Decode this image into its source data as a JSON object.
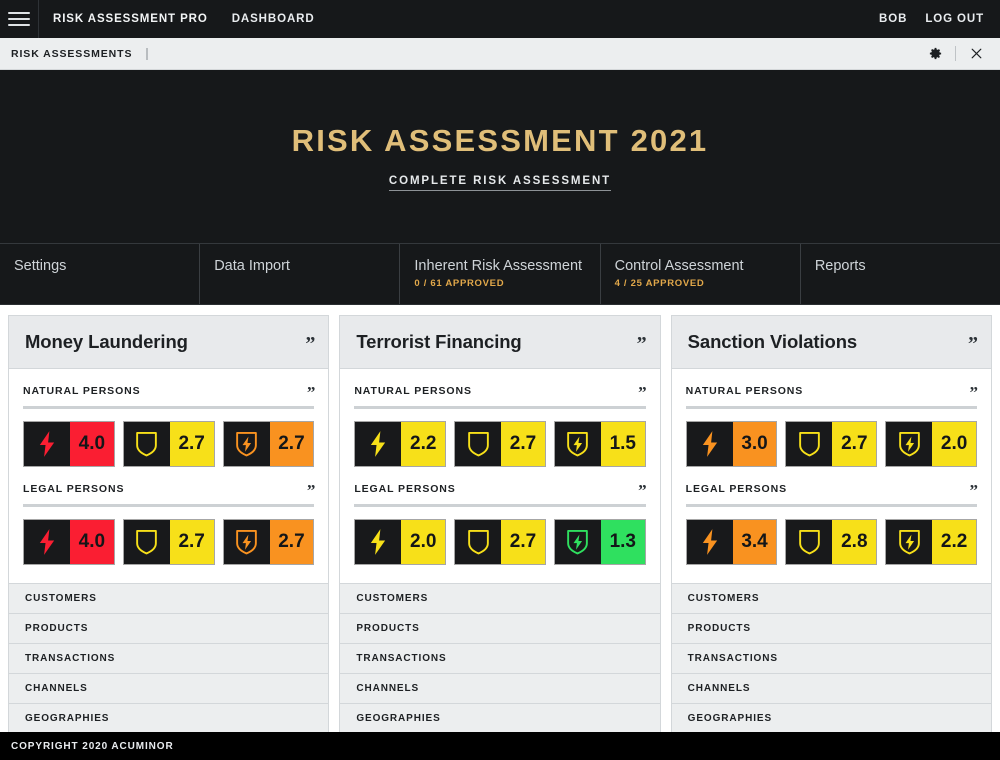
{
  "topnav": {
    "menu_icon": "hamburger-icon",
    "brand": "RISK ASSESSMENT PRO",
    "dashboard": "DASHBOARD",
    "user": "BOB",
    "logout": "LOG OUT"
  },
  "subbar": {
    "tab": "RISK ASSESSMENTS",
    "settings_icon": "gear-icon",
    "close_icon": "close-icon"
  },
  "hero": {
    "title": "RISK ASSESSMENT 2021",
    "subtitle": "COMPLETE RISK ASSESSMENT",
    "title_color": "#e0be79"
  },
  "tabs": [
    {
      "label": "Settings",
      "meta": ""
    },
    {
      "label": "Data Import",
      "meta": ""
    },
    {
      "label": "Inherent Risk Assessment",
      "meta": "0 / 61 APPROVED"
    },
    {
      "label": "Control Assessment",
      "meta": "4 / 25 APPROVED"
    },
    {
      "label": "Reports",
      "meta": ""
    }
  ],
  "badge_icons": {
    "inherent": "lightning-bolt-icon",
    "control": "shield-icon",
    "residual": "shield-bolt-icon"
  },
  "colors": {
    "red": "#fa1e32",
    "orange": "#f99220",
    "yellow": "#f7e019",
    "green": "#2fe05f",
    "dark": "#18191b"
  },
  "cards": [
    {
      "title": "Money Laundering",
      "sections": [
        {
          "title": "NATURAL PERSONS",
          "badges": [
            {
              "icon": "lightning-bolt-icon",
              "value": "4.0",
              "color": "#fa1e32"
            },
            {
              "icon": "shield-icon",
              "value": "2.7",
              "color": "#f7e019"
            },
            {
              "icon": "shield-bolt-icon",
              "value": "2.7",
              "color": "#f99220"
            }
          ]
        },
        {
          "title": "LEGAL PERSONS",
          "badges": [
            {
              "icon": "lightning-bolt-icon",
              "value": "4.0",
              "color": "#fa1e32"
            },
            {
              "icon": "shield-icon",
              "value": "2.7",
              "color": "#f7e019"
            },
            {
              "icon": "shield-bolt-icon",
              "value": "2.7",
              "color": "#f99220"
            }
          ]
        }
      ],
      "rows": [
        "CUSTOMERS",
        "PRODUCTS",
        "TRANSACTIONS",
        "CHANNELS",
        "GEOGRAPHIES"
      ]
    },
    {
      "title": "Terrorist Financing",
      "sections": [
        {
          "title": "NATURAL PERSONS",
          "badges": [
            {
              "icon": "lightning-bolt-icon",
              "value": "2.2",
              "color": "#f7e019"
            },
            {
              "icon": "shield-icon",
              "value": "2.7",
              "color": "#f7e019"
            },
            {
              "icon": "shield-bolt-icon",
              "value": "1.5",
              "color": "#f7e019"
            }
          ]
        },
        {
          "title": "LEGAL PERSONS",
          "badges": [
            {
              "icon": "lightning-bolt-icon",
              "value": "2.0",
              "color": "#f7e019"
            },
            {
              "icon": "shield-icon",
              "value": "2.7",
              "color": "#f7e019"
            },
            {
              "icon": "shield-bolt-icon",
              "value": "1.3",
              "color": "#2fe05f"
            }
          ]
        }
      ],
      "rows": [
        "CUSTOMERS",
        "PRODUCTS",
        "TRANSACTIONS",
        "CHANNELS",
        "GEOGRAPHIES"
      ]
    },
    {
      "title": "Sanction Violations",
      "sections": [
        {
          "title": "NATURAL PERSONS",
          "badges": [
            {
              "icon": "lightning-bolt-icon",
              "value": "3.0",
              "color": "#f99220"
            },
            {
              "icon": "shield-icon",
              "value": "2.7",
              "color": "#f7e019"
            },
            {
              "icon": "shield-bolt-icon",
              "value": "2.0",
              "color": "#f7e019"
            }
          ]
        },
        {
          "title": "LEGAL PERSONS",
          "badges": [
            {
              "icon": "lightning-bolt-icon",
              "value": "3.4",
              "color": "#f99220"
            },
            {
              "icon": "shield-icon",
              "value": "2.8",
              "color": "#f7e019"
            },
            {
              "icon": "shield-bolt-icon",
              "value": "2.2",
              "color": "#f7e019"
            }
          ]
        }
      ],
      "rows": [
        "CUSTOMERS",
        "PRODUCTS",
        "TRANSACTIONS",
        "CHANNELS",
        "GEOGRAPHIES"
      ]
    }
  ],
  "footer": {
    "copyright": "COPYRIGHT 2020 ACUMINOR"
  }
}
